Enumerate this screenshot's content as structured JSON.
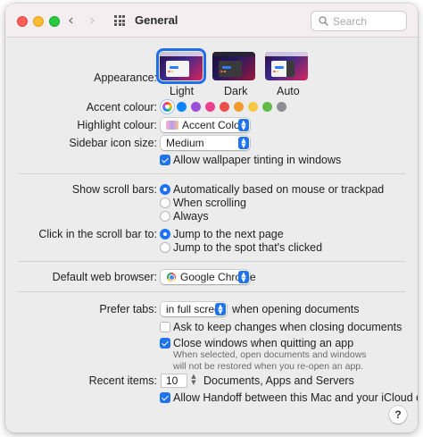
{
  "window": {
    "title": "General",
    "search_placeholder": "Search",
    "help_label": "?"
  },
  "appearance": {
    "label": "Appearance:",
    "options": [
      {
        "label": "Light",
        "selected": true
      },
      {
        "label": "Dark",
        "selected": false
      },
      {
        "label": "Auto",
        "selected": false
      }
    ]
  },
  "accent": {
    "label": "Accent colour:",
    "colors": [
      "multicolor",
      "#0a84ff",
      "#9c4fd9",
      "#e8428c",
      "#ec4f4a",
      "#f39b2e",
      "#f7c843",
      "#62ba46",
      "#8e8e93"
    ],
    "selected": "multicolor"
  },
  "highlight": {
    "label": "Highlight colour:",
    "value": "Accent Colour"
  },
  "sidebar_icon": {
    "label": "Sidebar icon size:",
    "value": "Medium"
  },
  "wallpaper_tinting": {
    "label": "Allow wallpaper tinting in windows",
    "checked": true
  },
  "scroll_bars": {
    "label": "Show scroll bars:",
    "options": [
      {
        "label": "Automatically based on mouse or trackpad",
        "selected": true
      },
      {
        "label": "When scrolling",
        "selected": false
      },
      {
        "label": "Always",
        "selected": false
      }
    ]
  },
  "scroll_click": {
    "label": "Click in the scroll bar to:",
    "options": [
      {
        "label": "Jump to the next page",
        "selected": true
      },
      {
        "label": "Jump to the spot that's clicked",
        "selected": false
      }
    ]
  },
  "browser": {
    "label": "Default web browser:",
    "value": "Google Chrome"
  },
  "tabs": {
    "label": "Prefer tabs:",
    "value": "in full screen",
    "suffix": "when opening documents"
  },
  "ask_keep_changes": {
    "label": "Ask to keep changes when closing documents",
    "checked": false
  },
  "close_windows": {
    "label": "Close windows when quitting an app",
    "checked": true,
    "note": "When selected, open documents and windows will not be restored when you re-open an app."
  },
  "recent_items": {
    "label": "Recent items:",
    "value": "10",
    "suffix": "Documents, Apps and Servers"
  },
  "handoff": {
    "label": "Allow Handoff between this Mac and your iCloud devices",
    "checked": true
  }
}
